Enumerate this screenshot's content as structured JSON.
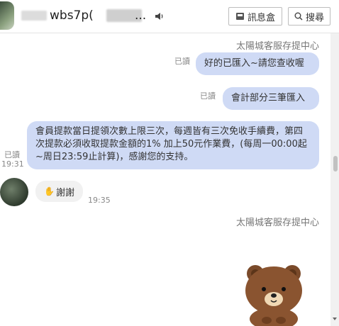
{
  "header": {
    "title_visible": "wbs7p(",
    "title_tail": "...",
    "inbox_label": "訊息盒",
    "search_label": "搜尋"
  },
  "messages": {
    "sender_top": "太陽城客服存提中心",
    "out1": "好的已匯入~請您查收喔",
    "out1_read": "已讀",
    "out2": "會計部分三筆匯入",
    "out2_read": "已讀",
    "out3": "會員提款當日提領次數上限三次，每週皆有三次免收手續費，第四次提款必須收取提款金額的1% 加上50元作業費，(每周一00:00起~周日23:59止計算)，感謝您的支持。",
    "out3_read": "已讀",
    "out3_time": "19:31",
    "in1": "謝謝",
    "in1_time": "19:35",
    "sender_bottom": "太陽城客服存提中心"
  }
}
